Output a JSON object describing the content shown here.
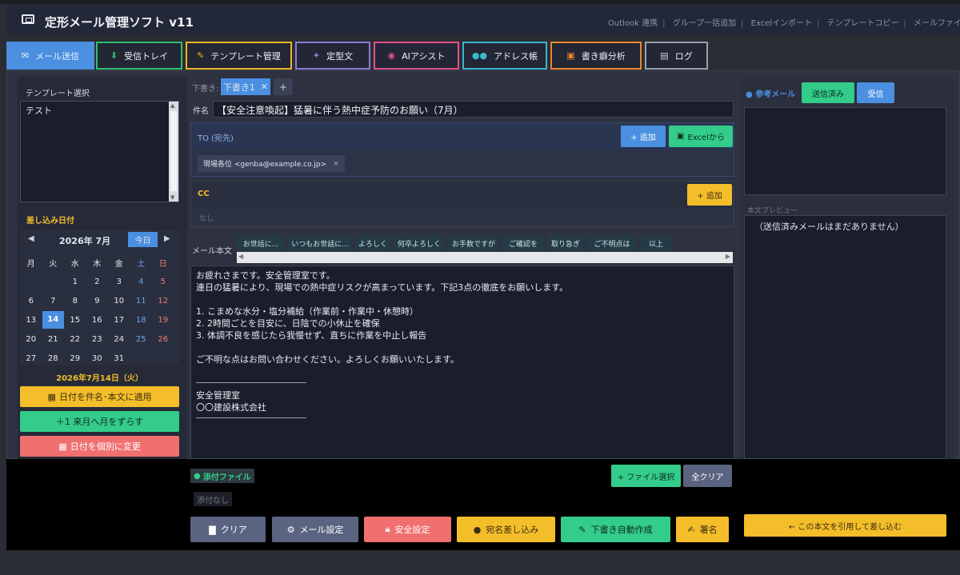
{
  "app": {
    "title": "定形メール管理ソフト  v11"
  },
  "top_links": [
    "Outlook 連携",
    "グループ一括追加",
    "Excelインポート",
    "テンプレートコピー",
    "メールファイル読み込み"
  ],
  "tabs": [
    {
      "label": "メール送信",
      "icon": "mail-icon",
      "color": "#4a8fe0"
    },
    {
      "label": "受信トレイ",
      "icon": "inbox-icon",
      "color": "#2fbf71"
    },
    {
      "label": "テンプレート管理",
      "icon": "edit-icon",
      "color": "#e8b62a"
    },
    {
      "label": "定型文",
      "icon": "pin-icon",
      "color": "#8f7ad8"
    },
    {
      "label": "AIアシスト",
      "icon": "robot-icon",
      "color": "#e0508a"
    },
    {
      "label": "アドレス帳",
      "icon": "people-icon",
      "color": "#3ab7cf"
    },
    {
      "label": "書き癖分析",
      "icon": "chart-icon",
      "color": "#e8862a"
    },
    {
      "label": "ログ",
      "icon": "log-icon",
      "color": "#9aa0ad"
    }
  ],
  "left": {
    "template_label": "テンプレート選択",
    "templates": [
      "テスト"
    ],
    "date_label": "差し込み日付",
    "calendar": {
      "month_label": "2026年 7月",
      "today_label": "今日",
      "weekdays": [
        "月",
        "火",
        "水",
        "木",
        "金",
        "土",
        "日"
      ],
      "weeks": [
        [
          "",
          "",
          "1",
          "2",
          "3",
          "4",
          "5"
        ],
        [
          "6",
          "7",
          "8",
          "9",
          "10",
          "11",
          "12"
        ],
        [
          "13",
          "14",
          "15",
          "16",
          "17",
          "18",
          "19"
        ],
        [
          "20",
          "21",
          "22",
          "23",
          "24",
          "25",
          "26"
        ],
        [
          "27",
          "28",
          "29",
          "30",
          "31",
          "",
          ""
        ]
      ],
      "selected_day": "14"
    },
    "selected_date": "2026年7月14日（火）",
    "apply_button": "日付を件名･本文に適用",
    "shift_button": "＋1  来月へ月をずらす",
    "individual_button": "日付を個別に変更"
  },
  "compose": {
    "draft_label": "下書き:",
    "draft_tab": "下書き1",
    "add_draft": "+",
    "subject_label": "件名",
    "subject": "【安全注意喚起】猛暑に伴う熱中症予防のお願い（7月）",
    "to_label": "TO (宛先)",
    "to_add": "+ 追加",
    "to_excel": "Excelから",
    "to_chip": "現場各位 <genba@example.co.jp>",
    "cc_label": "CC",
    "cc_add": "+ 追加",
    "cc_empty": "なし",
    "body_label": "メール本文",
    "phrases": [
      "お世話に...",
      "いつもお世話に...",
      "よろしく",
      "何卒よろしく",
      "お手数ですが",
      "ご確認を",
      "取り急ぎ",
      "ご不明点は",
      "以上"
    ],
    "body": "お疲れさまです。安全管理室です。\n連日の猛暑により、現場での熱中症リスクが高まっています。下記3点の徹底をお願いします。\n\n1. こまめな水分・塩分補給（作業前・作業中・休憩時）\n2. 2時間ごとを目安に、日陰での小休止を確保\n3. 体調不良を感じたら我慢せず、直ちに作業を中止し報告\n\nご不明な点はお問い合わせください。よろしくお願いいたします。\n\n\n安全管理室\n〇〇建設株式会社"
  },
  "attachments": {
    "label": "添付ファイル",
    "empty": "添付なし",
    "select_button": "+ ファイル選択",
    "clear_button": "全クリア"
  },
  "actions": [
    {
      "label": "クリア",
      "icon": "trash-icon",
      "color": "#5a6480"
    },
    {
      "label": "メール設定",
      "icon": "gear-icon",
      "color": "#5a6480"
    },
    {
      "label": "安全設定",
      "icon": "lock-icon",
      "color": "#f06f6f"
    },
    {
      "label": "宛名差し込み",
      "icon": "person-icon",
      "color": "#f4bd2a"
    },
    {
      "label": "下書き自動作成",
      "icon": "pencil-icon",
      "color": "#33cc8a"
    },
    {
      "label": "署名",
      "icon": "sign-icon",
      "color": "#f4bd2a"
    }
  ],
  "right": {
    "ref_label": "参考メール",
    "sent_tab": "送信済み",
    "received_tab": "受信",
    "preview_label": "本文プレビュー",
    "preview_text": "（送信済みメールはまだありません）",
    "quote_button": "← この本文を引用して差し込む"
  }
}
